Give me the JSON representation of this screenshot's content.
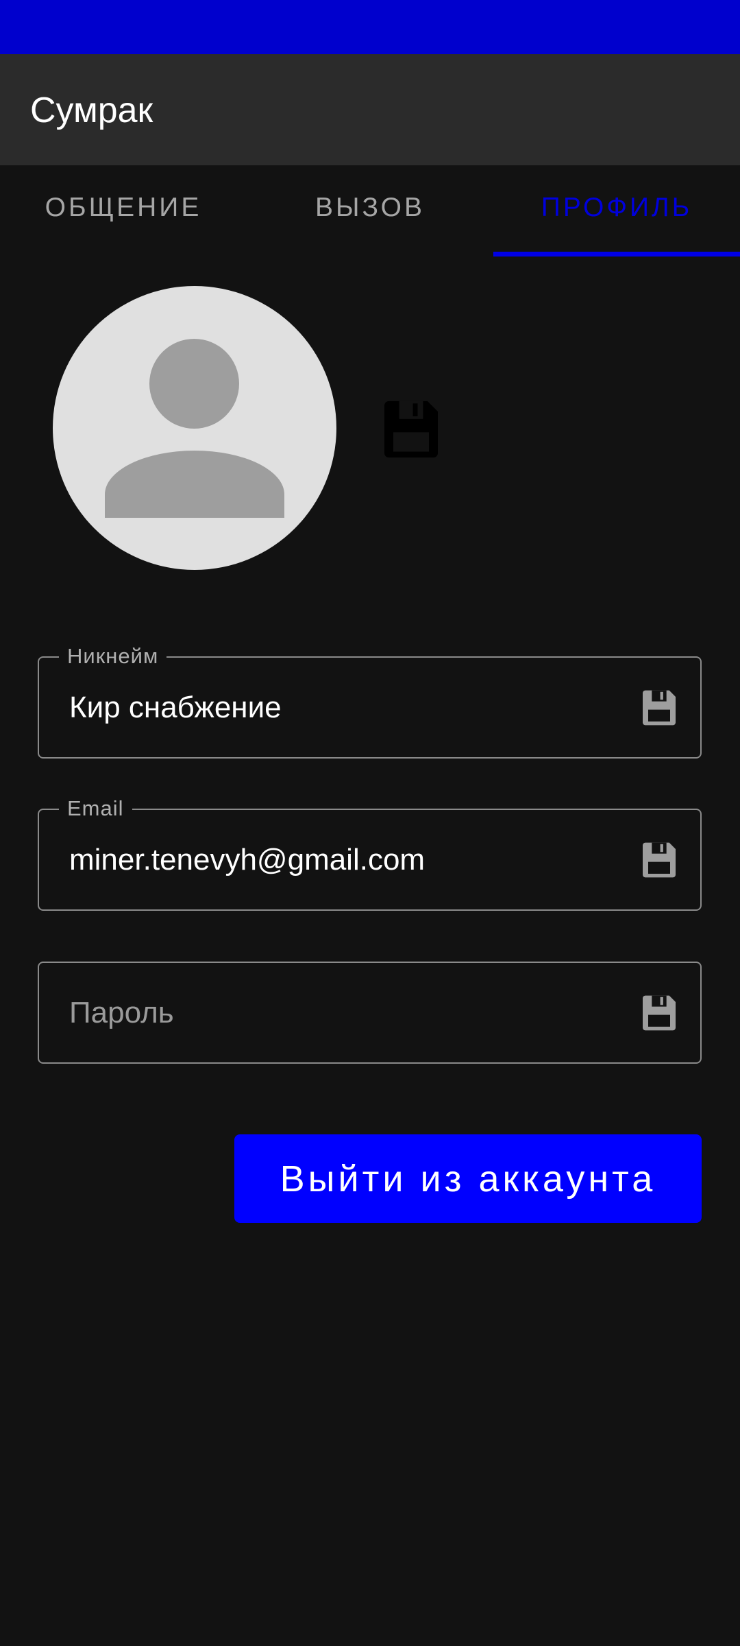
{
  "app": {
    "title": "Сумрак"
  },
  "tabs": [
    {
      "label": "ОБЩЕНИЕ",
      "active": false
    },
    {
      "label": "ВЫЗОВ",
      "active": false
    },
    {
      "label": "ПРОФИЛЬ",
      "active": true
    }
  ],
  "profile": {
    "avatar_icon": "person-placeholder-icon",
    "avatar_save_icon": "floppy-disk-icon",
    "fields": {
      "nickname": {
        "label": "Никнейм",
        "value": "Кир снабжение",
        "save_icon": "floppy-disk-icon"
      },
      "email": {
        "label": "Email",
        "value": "miner.tenevyh@gmail.com",
        "save_icon": "floppy-disk-icon"
      },
      "password": {
        "placeholder": "Пароль",
        "value": "",
        "save_icon": "floppy-disk-icon"
      }
    },
    "logout_label": "Выйти из аккаунта"
  },
  "colors": {
    "status_bar": "#0000cd",
    "app_bar": "#2b2b2b",
    "background": "#121212",
    "accent": "#0000ff",
    "active_tab": "#0000dd"
  }
}
